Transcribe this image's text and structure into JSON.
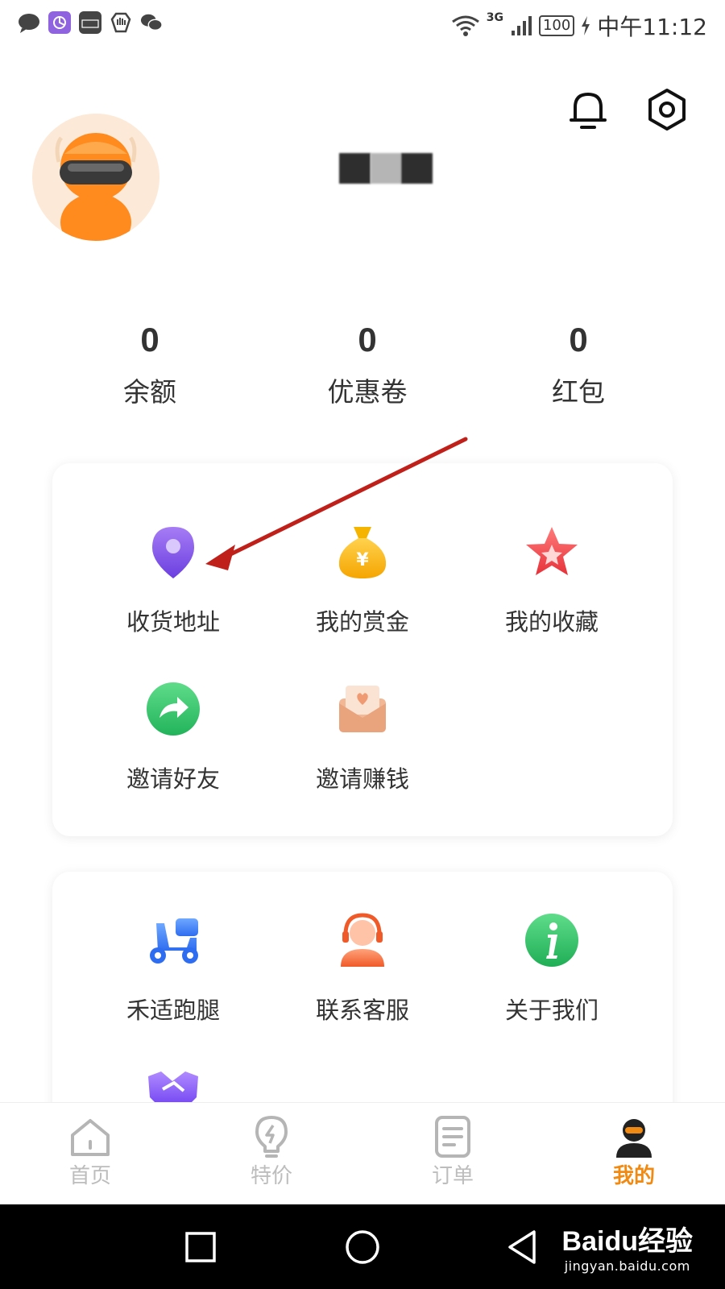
{
  "status_bar": {
    "network": "3G",
    "battery": "100",
    "time": "中午11:12"
  },
  "header": {
    "notification_icon": "bell-icon",
    "settings_icon": "settings-hex-icon"
  },
  "stats": [
    {
      "value": "0",
      "label": "余额"
    },
    {
      "value": "0",
      "label": "优惠卷"
    },
    {
      "value": "0",
      "label": "红包"
    }
  ],
  "card1": {
    "items": [
      {
        "label": "收货地址",
        "icon": "location-pin-icon"
      },
      {
        "label": "我的赏金",
        "icon": "money-bag-icon"
      },
      {
        "label": "我的收藏",
        "icon": "star-icon"
      },
      {
        "label": "邀请好友",
        "icon": "share-arrow-icon"
      },
      {
        "label": "邀请赚钱",
        "icon": "envelope-heart-icon"
      }
    ]
  },
  "card2": {
    "items": [
      {
        "label": "禾适跑腿",
        "icon": "scooter-icon"
      },
      {
        "label": "联系客服",
        "icon": "customer-service-icon"
      },
      {
        "label": "关于我们",
        "icon": "info-icon"
      },
      {
        "label": "",
        "icon": "handshake-icon"
      }
    ]
  },
  "bottom_nav": [
    {
      "label": "首页",
      "icon": "home-icon"
    },
    {
      "label": "特价",
      "icon": "lightbulb-icon"
    },
    {
      "label": "订单",
      "icon": "order-list-icon"
    },
    {
      "label": "我的",
      "icon": "profile-icon",
      "active": true
    }
  ],
  "colors": {
    "accent": "#f08a12",
    "inactive_nav": "#bdbdbd",
    "annotation_arrow": "#c0201a"
  },
  "watermark": {
    "brand": "Baidu经验",
    "url": "jingyan.baidu.com"
  }
}
